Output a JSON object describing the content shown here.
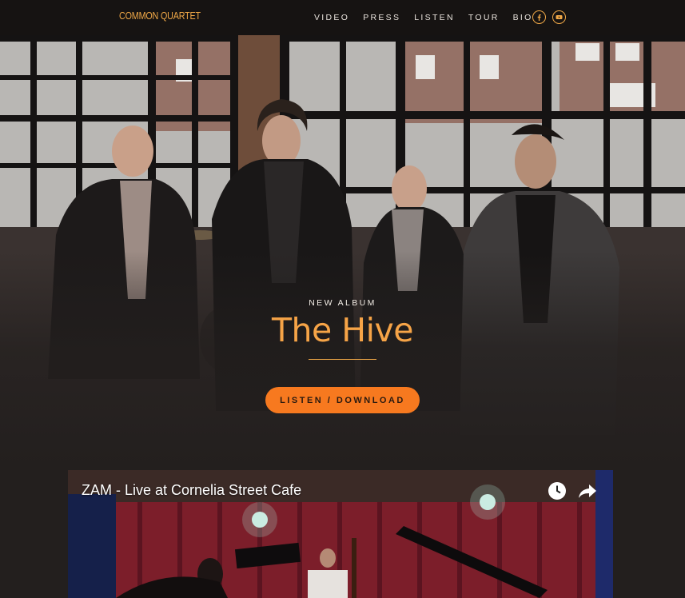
{
  "brand": "COMMON QUARTET",
  "nav": {
    "items": [
      "VIDEO",
      "PRESS",
      "LISTEN",
      "TOUR",
      "BIO"
    ],
    "social": [
      "facebook-icon",
      "youtube-icon"
    ]
  },
  "hero": {
    "eyebrow": "NEW ALBUM",
    "title": "The Hive",
    "cta": "LISTEN / DOWNLOAD"
  },
  "video": {
    "title": "ZAM - Live at Cornelia Street Cafe",
    "icons": [
      "watch-later-icon",
      "share-icon"
    ]
  },
  "colors": {
    "accent": "#f0a847",
    "cta": "#f7791f",
    "background": "#231f1e",
    "topbar": "#161312"
  }
}
